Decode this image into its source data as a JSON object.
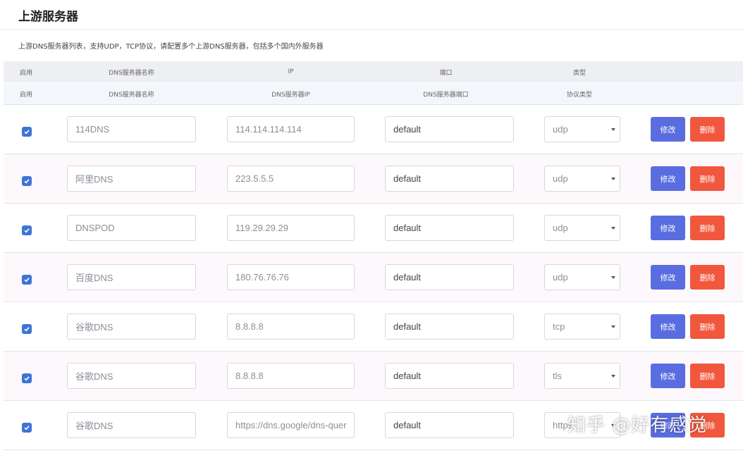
{
  "panel": {
    "title": "上游服务器",
    "description": "上游DNS服务器列表，支持UDP，TCP协议，请配置多个上游DNS服务器，包括多个国内外服务器"
  },
  "header1": {
    "enabled": "启用",
    "name": "DNS服务器名称",
    "ip": "IP",
    "port": "端口",
    "type": "类型"
  },
  "header2": {
    "enabled": "启用",
    "name": "DNS服务器名称",
    "ip": "DNS服务器IP",
    "port": "DNS服务器端口",
    "type": "协议类型"
  },
  "rows": [
    {
      "checked": true,
      "name": "114DNS",
      "ip": "114.114.114.114",
      "port": "default",
      "protocol": "udp",
      "edit": "修改",
      "delete": "删除"
    },
    {
      "checked": true,
      "name": "阿里DNS",
      "ip": "223.5.5.5",
      "port": "default",
      "protocol": "udp",
      "edit": "修改",
      "delete": "删除"
    },
    {
      "checked": true,
      "name": "DNSPOD",
      "ip": "119.29.29.29",
      "port": "default",
      "protocol": "udp",
      "edit": "修改",
      "delete": "删除"
    },
    {
      "checked": true,
      "name": "百度DNS",
      "ip": "180.76.76.76",
      "port": "default",
      "protocol": "udp",
      "edit": "修改",
      "delete": "删除"
    },
    {
      "checked": true,
      "name": "谷歌DNS",
      "ip": "8.8.8.8",
      "port": "default",
      "protocol": "tcp",
      "edit": "修改",
      "delete": "删除"
    },
    {
      "checked": true,
      "name": "谷歌DNS",
      "ip": "8.8.8.8",
      "port": "default",
      "protocol": "tls",
      "edit": "修改",
      "delete": "删除"
    },
    {
      "checked": true,
      "name": "谷歌DNS",
      "ip": "https://dns.google/dns-quer",
      "port": "default",
      "protocol": "https",
      "edit": "修改",
      "delete": "删除"
    }
  ],
  "watermark": "知乎 @好有感觉",
  "colors": {
    "edit_button": "#5a6de0",
    "delete_button": "#f0573d",
    "checkbox": "#3e74d6"
  },
  "icons": {
    "checkbox": "check-icon",
    "select": "caret-down-icon"
  }
}
